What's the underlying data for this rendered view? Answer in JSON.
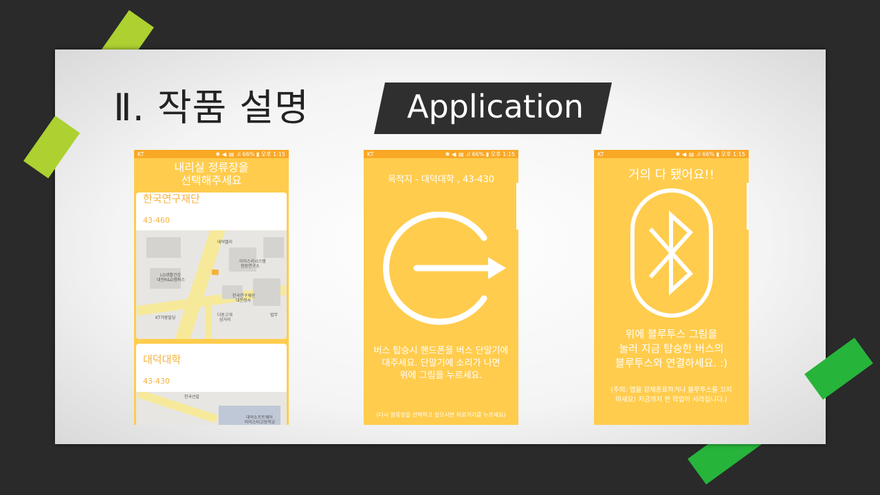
{
  "slide": {
    "title": "Ⅱ. 작품 설명",
    "banner": "Application"
  },
  "status_bar": {
    "carrier": "KT",
    "right": "✱ ◀ᵢ ▤ .ıl 66% ▮ 오후 1:15"
  },
  "screen1": {
    "header_line1": "내리실 정류장을",
    "header_line2": "선택해주세요",
    "stops": [
      {
        "name": "한국연구재단",
        "code": "43-460",
        "map_labels": [
          "대덕밸리",
          "아이스리시스템",
          "정동연구소",
          "LG생활건강",
          "대전R&D캠퍼스",
          "한국연구재단",
          "대전청사",
          "KT가람빌딩",
          "다동고개",
          "삼거리",
          "법무"
        ]
      },
      {
        "name": "대덕대학",
        "code": "43-430",
        "map_labels": [
          "한국선갈",
          "대덕소프트웨어",
          "마이스터고등학교"
        ]
      }
    ]
  },
  "screen2": {
    "destination": "목적지 -  대덕대학  ,  43-430",
    "message_line1": "버스 탑승시 핸드폰을 버스 단말기에",
    "message_line2": "대주세요. 단말기에 소리가 나면",
    "message_line3": "위에 그림을 누르세요.",
    "note": "(다시 정류장을 선택하고 싶으시면 뒤로가기를 누르세요)"
  },
  "screen3": {
    "header": "거의 다 됐어요!!",
    "message_line1": "위에 블루투스 그림을",
    "message_line2": "눌러 지금 탑승한 버스의",
    "message_line3": "블루투스와 연결하세요.  :)",
    "note_line1": "(주의: 앱을 강제종료하거나 블루투스를 끄지",
    "note_line2": "마세요! 지금까지 한 작업이 사라집니다.)"
  },
  "colors": {
    "phone_bg": "#ffcc4d",
    "status_bg": "#f9a825",
    "tape_left": "#acd130",
    "tape_right": "#27b43b"
  }
}
